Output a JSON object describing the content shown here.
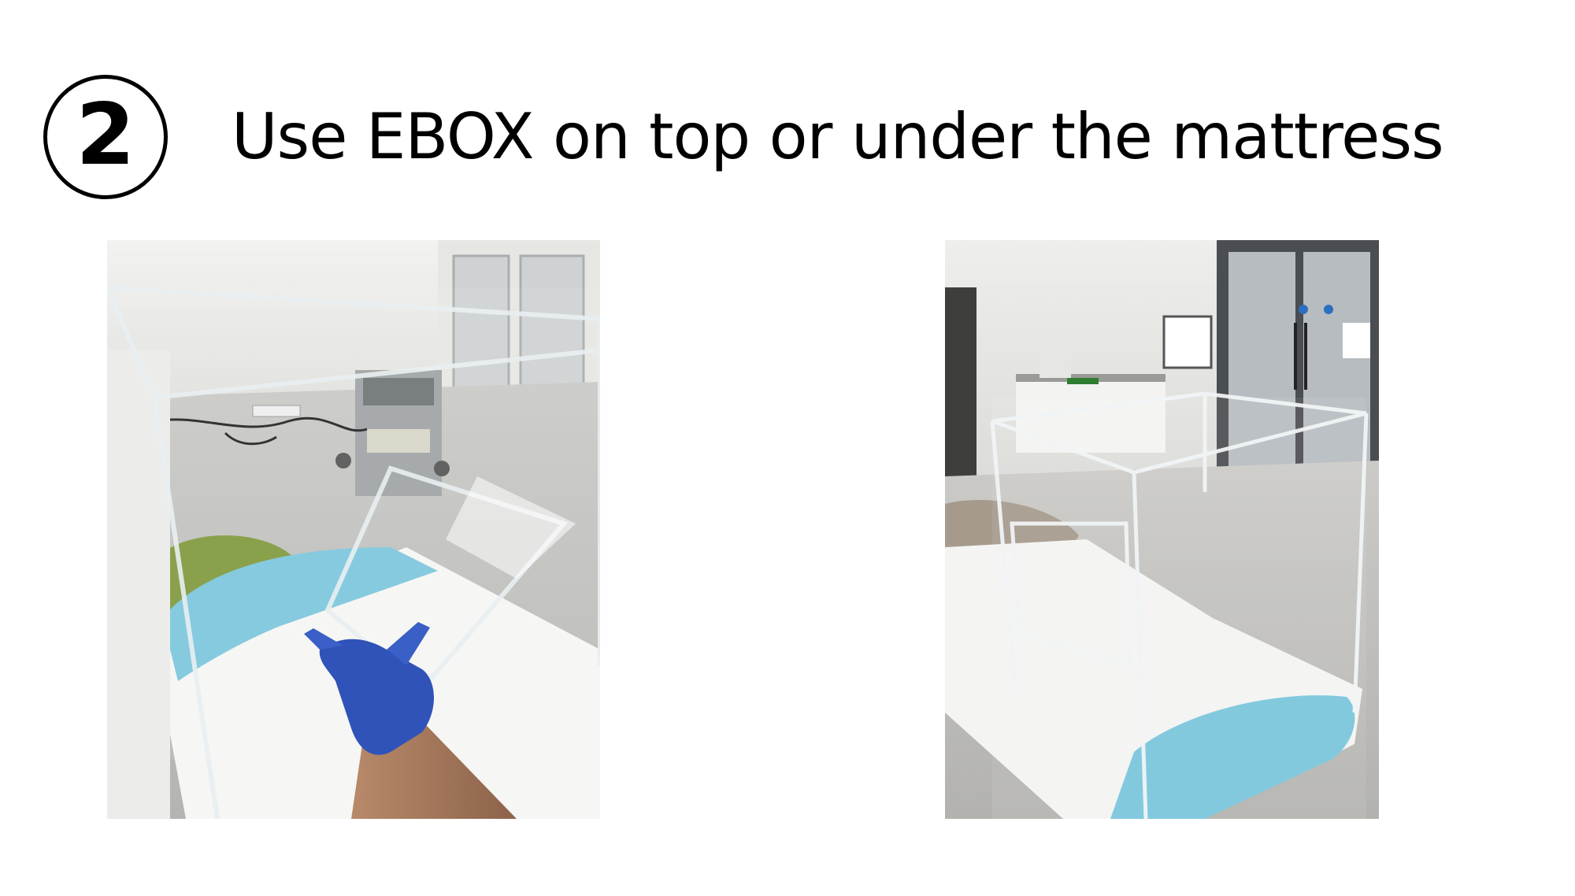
{
  "step": {
    "number": "2"
  },
  "title": "Use EBOX on top or under the mattress",
  "photos": [
    {
      "subject": "ebox-on-top-of-mattress-photo"
    },
    {
      "subject": "ebox-under-mattress-photo"
    }
  ]
}
